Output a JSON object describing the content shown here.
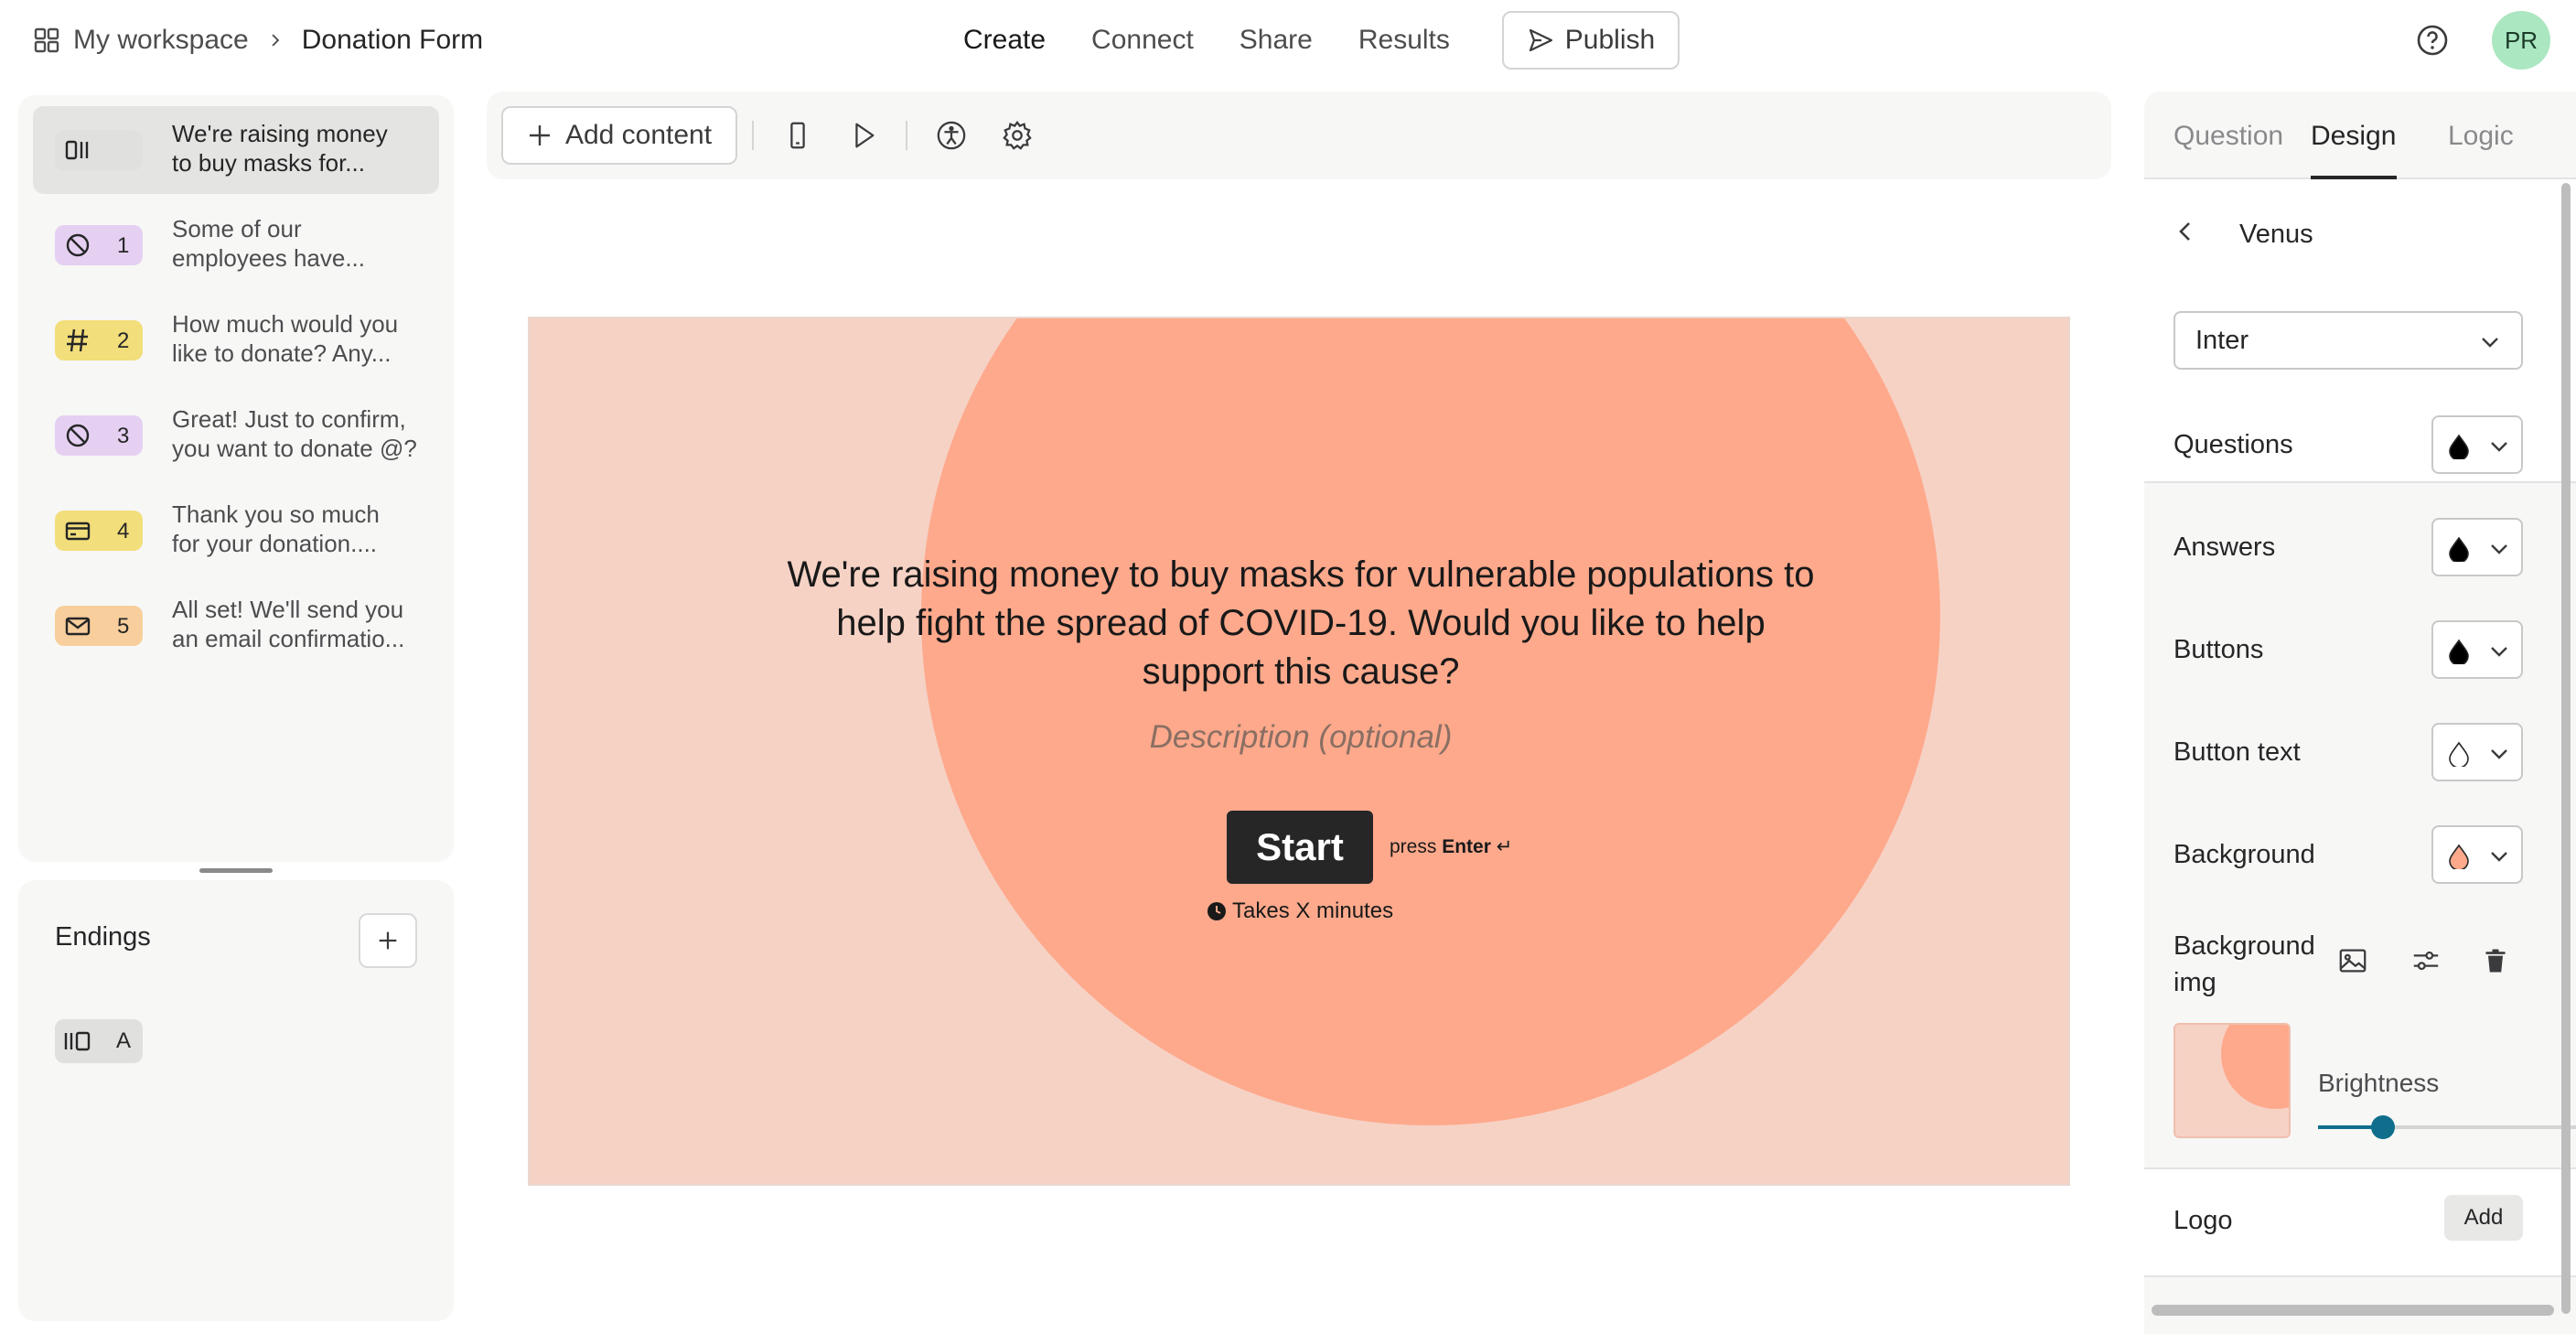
{
  "breadcrumb": {
    "workspace": "My workspace",
    "form_name": "Donation Form"
  },
  "nav": {
    "create": "Create",
    "connect": "Connect",
    "share": "Share",
    "results": "Results",
    "publish": "Publish"
  },
  "user": {
    "initials": "PR",
    "avatar_color": "#abe7c1"
  },
  "questions": [
    {
      "num": "",
      "icon": "statement-icon",
      "text_l1": "We're raising money",
      "text_l2": "to buy masks for...",
      "badge_color": "#e0e0df"
    },
    {
      "num": "1",
      "icon": "yes-no-icon",
      "text_l1": "Some of our",
      "text_l2": "employees have...",
      "badge_color": "#e5d0f2"
    },
    {
      "num": "2",
      "icon": "number-icon",
      "text_l1": "How much would you",
      "text_l2": "like to donate? Any...",
      "badge_color": "#f2de7a"
    },
    {
      "num": "3",
      "icon": "yes-no-icon",
      "text_l1": "Great! Just to confirm,",
      "text_l2": "you want to donate @?",
      "badge_color": "#e5d0f2"
    },
    {
      "num": "4",
      "icon": "payment-icon",
      "text_l1": "Thank you so much",
      "text_l2": "for your donation....",
      "badge_color": "#f2de7a"
    },
    {
      "num": "5",
      "icon": "email-icon",
      "text_l1": "All set! We'll send you",
      "text_l2": "an email confirmatio...",
      "badge_color": "#f8cf9c"
    }
  ],
  "endings": {
    "title": "Endings",
    "items": [
      {
        "label": "A"
      }
    ]
  },
  "toolbar": {
    "add_content": "Add content"
  },
  "welcome": {
    "question_l1": "We're raising money to buy masks for vulnerable populations to",
    "question_l2": "help fight the spread of COVID-19. Would you like to help",
    "question_l3": "support this cause?",
    "description": "Description (optional)",
    "start": "Start",
    "press": "press",
    "enter": "Enter",
    "takes": "Takes X minutes",
    "bg_color": "#f6d2c5",
    "accent_color": "#fea98c"
  },
  "design": {
    "tabs": {
      "question": "Question",
      "design": "Design",
      "logic": "Logic"
    },
    "theme_name": "Venus",
    "font": "Inter",
    "colors": [
      {
        "label": "Questions",
        "value": "#000000"
      },
      {
        "label": "Answers",
        "value": "#000000"
      },
      {
        "label": "Buttons",
        "value": "#000000"
      },
      {
        "label": "Button text",
        "value": "#ffffff"
      },
      {
        "label": "Background",
        "value": "#fea98c"
      }
    ],
    "background_img_l1": "Background",
    "background_img_l2": "img",
    "brightness_label": "Brightness",
    "brightness": 0.25,
    "logo_label": "Logo",
    "logo_add": "Add"
  }
}
